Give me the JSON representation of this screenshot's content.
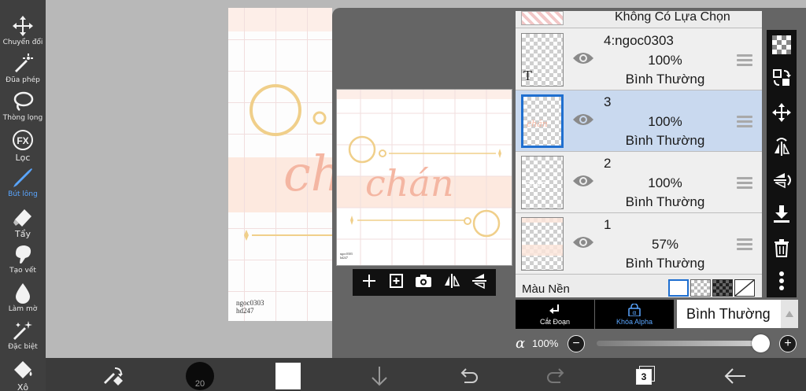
{
  "toolbar": {
    "tools": [
      {
        "name": "move",
        "label": "Chuyển đổi",
        "icon": "move-icon"
      },
      {
        "name": "magic-wand",
        "label": "Đũa phép",
        "icon": "magic-wand-icon"
      },
      {
        "name": "lasso",
        "label": "Thòng lọng",
        "icon": "lasso-icon"
      },
      {
        "name": "filter",
        "label": "Lọc",
        "icon": "fx-icon",
        "icon_text": "FX"
      },
      {
        "name": "brush",
        "label": "Bút lông",
        "icon": "brush-icon",
        "active": true
      },
      {
        "name": "eraser",
        "label": "Tẩy",
        "icon": "eraser-icon"
      },
      {
        "name": "smudge",
        "label": "Tạo vết",
        "icon": "smudge-icon"
      },
      {
        "name": "blur",
        "label": "Làm mờ",
        "icon": "drop-icon"
      },
      {
        "name": "special",
        "label": "Đặc biệt",
        "icon": "sparkle-wand-icon"
      },
      {
        "name": "bucket",
        "label": "Xô",
        "icon": "bucket-icon"
      }
    ]
  },
  "canvas": {
    "artwork_text": "chán",
    "credit_line1": "ngoc0303",
    "credit_line2": "hd247"
  },
  "preview": {
    "artwork_text": "chán",
    "credit_line1": "ngoc0303",
    "credit_line2": "hd247",
    "actions": [
      "add-layer-icon",
      "add-photo-layer-icon",
      "camera-icon",
      "flip-horizontal-icon",
      "flip-vertical-icon"
    ]
  },
  "layers": {
    "top_partial_label": "Không Có Lựa Chọn",
    "items": [
      {
        "name": "4:ngoc0303",
        "opacity": "100%",
        "blend": "Bình Thường",
        "selected": false,
        "thumb": "T"
      },
      {
        "name": "3",
        "opacity": "100%",
        "blend": "Bình Thường",
        "selected": true,
        "thumb": ""
      },
      {
        "name": "2",
        "opacity": "100%",
        "blend": "Bình Thường",
        "selected": false,
        "thumb": ""
      },
      {
        "name": "1",
        "opacity": "57%",
        "blend": "Bình Thường",
        "selected": false,
        "thumb": ""
      }
    ],
    "background_label": "Màu Nền"
  },
  "layer_tools": {
    "clip_label": "Cắt Đoạn",
    "alpha_lock_label": "Khóa Alpha",
    "blend_mode": "Bình Thường",
    "alpha_symbol": "α",
    "alpha_value": "100%",
    "alpha_fraction": 1.0
  },
  "right_icons": [
    "new-transparent-layer-icon",
    "layer-swap-icon",
    "move-icon",
    "flip-layer-horizontal-icon",
    "flip-layer-vertical-icon",
    "merge-down-icon",
    "trash-icon",
    "more-icon"
  ],
  "bottombar": {
    "brush_size": "20",
    "layer_count": "3"
  },
  "colors": {
    "accent": "#5aa6ff",
    "selected_layer": "#c9d9ef",
    "art_peach": "#f4b6a2",
    "art_gold": "#f0cf8a"
  }
}
